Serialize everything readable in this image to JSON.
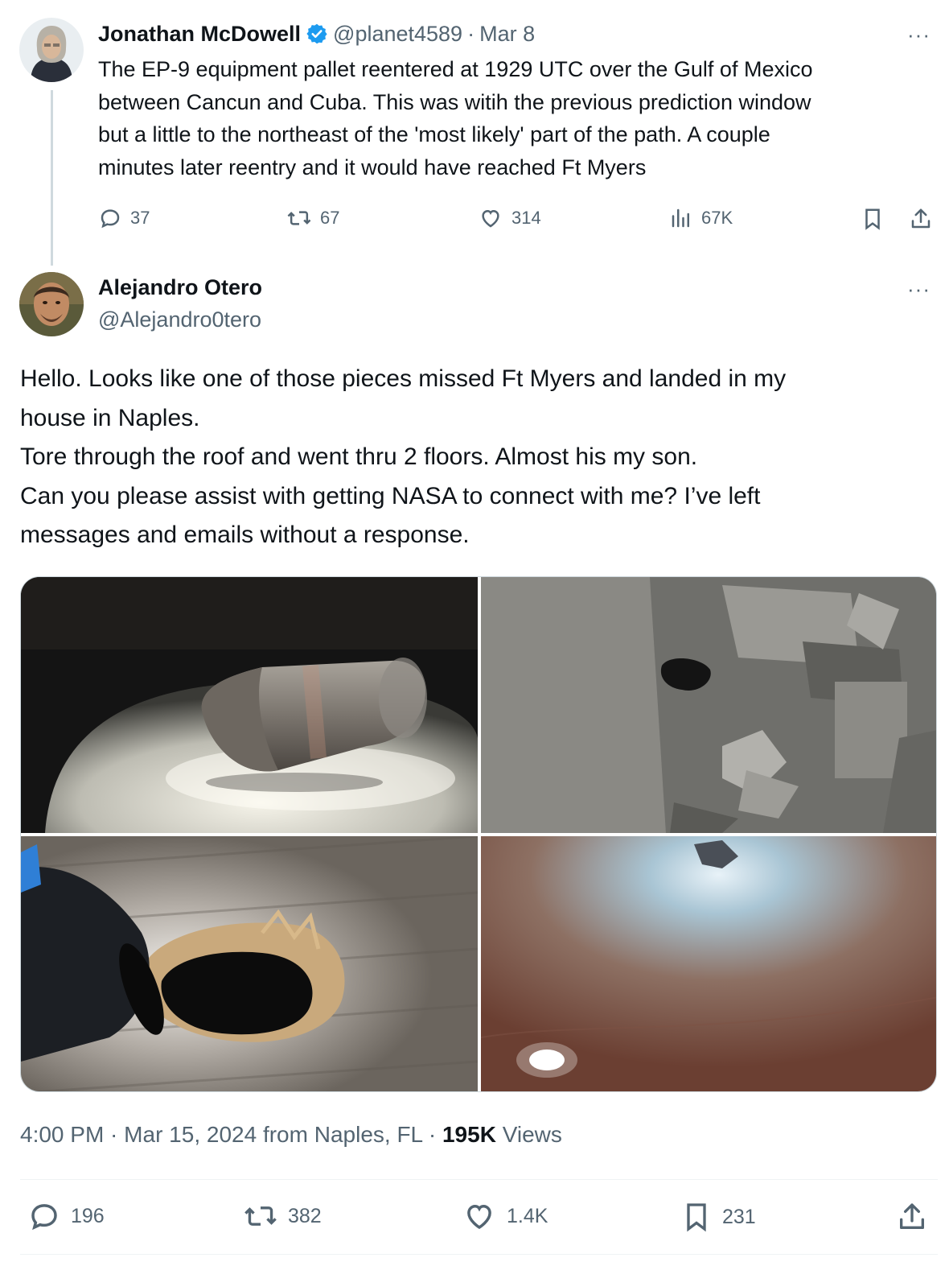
{
  "parent_tweet": {
    "author_name": "Jonathan McDowell",
    "verified": true,
    "handle": "@planet4589",
    "separator": " · ",
    "date": "Mar 8",
    "more_label": "···",
    "text": "The EP-9 equipment pallet reentered at 1929 UTC over the Gulf of Mexico\nbetween Cancun and Cuba. This was witih the previous prediction window\nbut a little to the northeast of the 'most likely' part of the path. A couple\nminutes later reentry and it would have reached Ft Myers",
    "stats": {
      "replies": "37",
      "reposts": "67",
      "likes": "314",
      "views": "67K"
    }
  },
  "main_tweet": {
    "author_name": "Alejandro Otero",
    "handle": "@Alejandro0tero",
    "more_label": "···",
    "text": "Hello. Looks like one of those pieces missed Ft Myers and landed in my\nhouse in Naples.\nTore through the roof and went  thru 2 floors. Almost his my son.\nCan you please assist with getting NASA to connect with me? I’ve left\nmessages and emails without a response.",
    "images": [
      {
        "id": "debris-cylinder"
      },
      {
        "id": "roof-damage"
      },
      {
        "id": "floor-hole"
      },
      {
        "id": "ceiling-hole"
      }
    ],
    "meta": {
      "time": "4:00 PM",
      "separator": " · ",
      "date": "Mar 15, 2024",
      "from_text": " from Naples, FL",
      "separator2": " · ",
      "views_count": "195K",
      "views_label": " Views"
    },
    "stats": {
      "replies": "196",
      "reposts": "382",
      "likes": "1.4K",
      "bookmarks": "231"
    }
  },
  "colors": {
    "text_primary": "#0f1419",
    "text_secondary": "#536471",
    "verified": "#1d9bf0",
    "border": "#cfd9de"
  }
}
